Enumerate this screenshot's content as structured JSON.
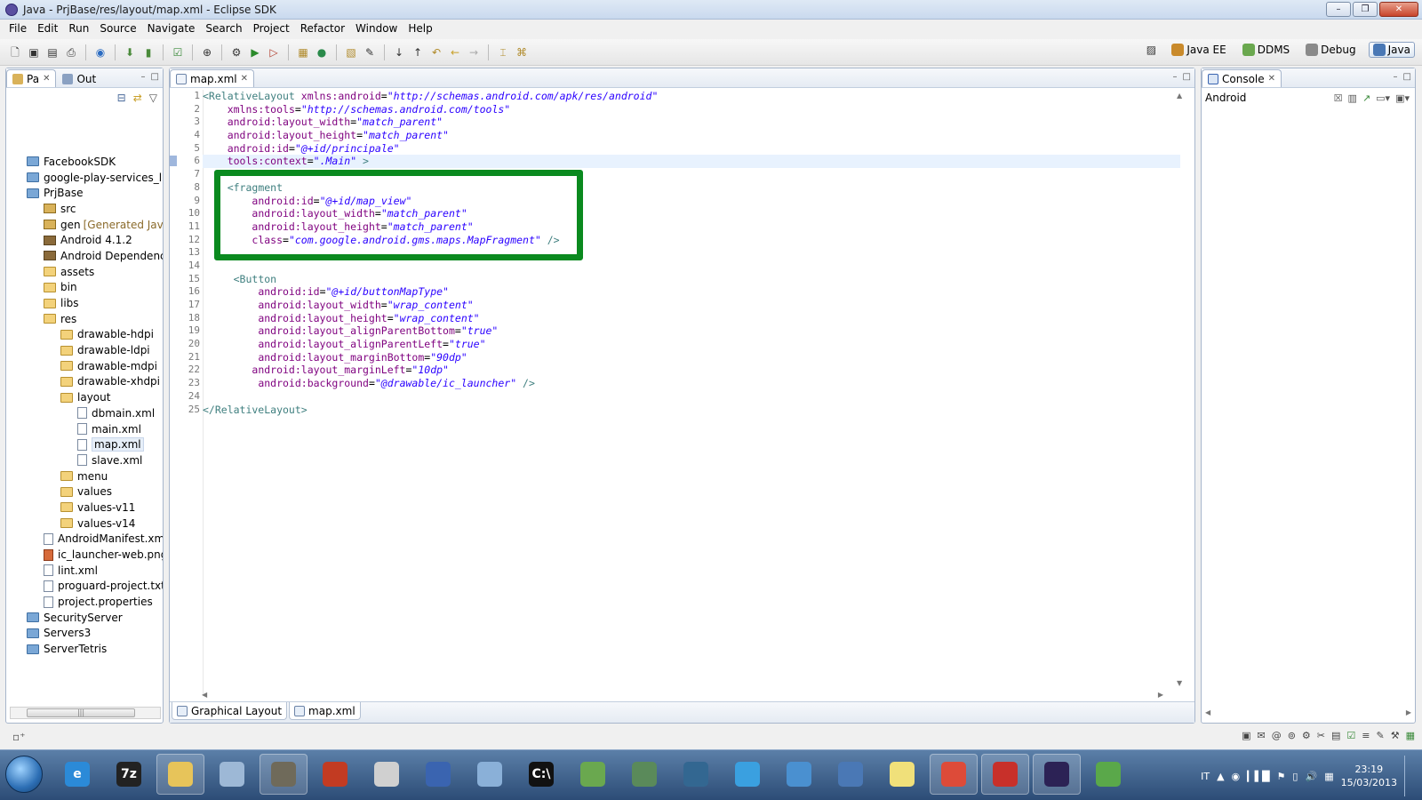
{
  "window": {
    "title": "Java - PrjBase/res/layout/map.xml - Eclipse SDK"
  },
  "menu": [
    "File",
    "Edit",
    "Run",
    "Source",
    "Navigate",
    "Search",
    "Project",
    "Refactor",
    "Window",
    "Help"
  ],
  "perspectives": [
    {
      "label": "Java EE",
      "color": "#c98a2b"
    },
    {
      "label": "DDMS",
      "color": "#6aa84f"
    },
    {
      "label": "Debug",
      "color": "#8a8a8a"
    },
    {
      "label": "Java",
      "color": "#4a78b5",
      "active": true
    }
  ],
  "explorer": {
    "tabs": [
      {
        "label": "Pa",
        "active": true
      },
      {
        "label": "Out",
        "active": false
      }
    ],
    "tree": [
      {
        "label": "FacebookSDK",
        "icon": "project-icon",
        "type": "proj",
        "indent": 1
      },
      {
        "label": "google-play-services_lib",
        "icon": "project-icon",
        "type": "proj",
        "indent": 1
      },
      {
        "label": "PrjBase",
        "icon": "project-icon",
        "type": "proj",
        "indent": 1
      },
      {
        "label": "src",
        "icon": "package-folder-icon",
        "type": "pkg",
        "indent": 2
      },
      {
        "label": "gen",
        "sub": "[Generated Java F",
        "icon": "package-folder-icon",
        "type": "pkg",
        "indent": 2
      },
      {
        "label": "Android 4.1.2",
        "icon": "library-icon",
        "type": "lib",
        "indent": 2
      },
      {
        "label": "Android Dependencie",
        "icon": "library-icon",
        "type": "lib",
        "indent": 2
      },
      {
        "label": "assets",
        "icon": "folder-icon",
        "type": "folder",
        "indent": 2
      },
      {
        "label": "bin",
        "icon": "folder-icon",
        "type": "folder",
        "indent": 2
      },
      {
        "label": "libs",
        "icon": "folder-icon",
        "type": "folder",
        "indent": 2
      },
      {
        "label": "res",
        "icon": "folder-icon",
        "type": "folder",
        "indent": 2
      },
      {
        "label": "drawable-hdpi",
        "icon": "folder-icon",
        "type": "folder",
        "indent": 3
      },
      {
        "label": "drawable-ldpi",
        "icon": "folder-icon",
        "type": "folder",
        "indent": 3
      },
      {
        "label": "drawable-mdpi",
        "icon": "folder-icon",
        "type": "folder",
        "indent": 3
      },
      {
        "label": "drawable-xhdpi",
        "icon": "folder-icon",
        "type": "folder",
        "indent": 3
      },
      {
        "label": "layout",
        "icon": "folder-icon",
        "type": "folder",
        "indent": 3
      },
      {
        "label": "dbmain.xml",
        "icon": "xml-file-icon",
        "type": "xml",
        "indent": 4
      },
      {
        "label": "main.xml",
        "icon": "xml-file-icon",
        "type": "xml",
        "indent": 4
      },
      {
        "label": "map.xml",
        "icon": "xml-file-icon",
        "type": "xml",
        "indent": 4,
        "selected": true
      },
      {
        "label": "slave.xml",
        "icon": "xml-file-icon",
        "type": "xml",
        "indent": 4
      },
      {
        "label": "menu",
        "icon": "folder-icon",
        "type": "folder",
        "indent": 3
      },
      {
        "label": "values",
        "icon": "folder-icon",
        "type": "folder",
        "indent": 3
      },
      {
        "label": "values-v11",
        "icon": "folder-icon",
        "type": "folder",
        "indent": 3
      },
      {
        "label": "values-v14",
        "icon": "folder-icon",
        "type": "folder",
        "indent": 3
      },
      {
        "label": "AndroidManifest.xml",
        "icon": "xml-file-icon",
        "type": "xml",
        "indent": 2
      },
      {
        "label": "ic_launcher-web.png",
        "icon": "image-file-icon",
        "type": "img",
        "indent": 2
      },
      {
        "label": "lint.xml",
        "icon": "xml-file-icon",
        "type": "xml",
        "indent": 2
      },
      {
        "label": "proguard-project.txt",
        "icon": "text-file-icon",
        "type": "file",
        "indent": 2
      },
      {
        "label": "project.properties",
        "icon": "text-file-icon",
        "type": "file",
        "indent": 2
      },
      {
        "label": "SecurityServer",
        "icon": "project-icon",
        "type": "proj",
        "indent": 1
      },
      {
        "label": "Servers3",
        "icon": "project-icon",
        "type": "proj",
        "indent": 1
      },
      {
        "label": "ServerTetris",
        "icon": "project-icon",
        "type": "proj",
        "indent": 1
      }
    ]
  },
  "editor": {
    "tab": "map.xml",
    "current_line": 6,
    "lines": [
      [
        [
          "t",
          "<RelativeLayout "
        ],
        [
          "a",
          "xmlns:android"
        ],
        [
          "p",
          "="
        ],
        [
          "v",
          "\"http://schemas.android.com/apk/res/android\""
        ]
      ],
      [
        [
          "p",
          "    "
        ],
        [
          "a",
          "xmlns:tools"
        ],
        [
          "p",
          "="
        ],
        [
          "v",
          "\"http://schemas.android.com/tools\""
        ]
      ],
      [
        [
          "p",
          "    "
        ],
        [
          "a",
          "android:layout_width"
        ],
        [
          "p",
          "="
        ],
        [
          "v",
          "\"match_parent\""
        ]
      ],
      [
        [
          "p",
          "    "
        ],
        [
          "a",
          "android:layout_height"
        ],
        [
          "p",
          "="
        ],
        [
          "v",
          "\"match_parent\""
        ]
      ],
      [
        [
          "p",
          "    "
        ],
        [
          "a",
          "android:id"
        ],
        [
          "p",
          "="
        ],
        [
          "v",
          "\"@+id/principale\""
        ]
      ],
      [
        [
          "p",
          "    "
        ],
        [
          "a",
          "tools:context"
        ],
        [
          "p",
          "="
        ],
        [
          "v",
          "\".Main\""
        ],
        [
          "t",
          " >"
        ]
      ],
      [],
      [
        [
          "p",
          "    "
        ],
        [
          "t",
          "<fragment"
        ]
      ],
      [
        [
          "p",
          "        "
        ],
        [
          "a",
          "android:id"
        ],
        [
          "p",
          "="
        ],
        [
          "v",
          "\"@+id/map_view\""
        ]
      ],
      [
        [
          "p",
          "        "
        ],
        [
          "a",
          "android:layout_width"
        ],
        [
          "p",
          "="
        ],
        [
          "v",
          "\"match_parent\""
        ]
      ],
      [
        [
          "p",
          "        "
        ],
        [
          "a",
          "android:layout_height"
        ],
        [
          "p",
          "="
        ],
        [
          "v",
          "\"match_parent\""
        ]
      ],
      [
        [
          "p",
          "        "
        ],
        [
          "a",
          "class"
        ],
        [
          "p",
          "="
        ],
        [
          "v",
          "\"com.google.android.gms.maps.MapFragment\""
        ],
        [
          "t",
          " />"
        ]
      ],
      [],
      [],
      [
        [
          "p",
          "     "
        ],
        [
          "t",
          "<Button"
        ]
      ],
      [
        [
          "p",
          "         "
        ],
        [
          "a",
          "android:id"
        ],
        [
          "p",
          "="
        ],
        [
          "v",
          "\"@+id/buttonMapType\""
        ]
      ],
      [
        [
          "p",
          "         "
        ],
        [
          "a",
          "android:layout_width"
        ],
        [
          "p",
          "="
        ],
        [
          "v",
          "\"wrap_content\""
        ]
      ],
      [
        [
          "p",
          "         "
        ],
        [
          "a",
          "android:layout_height"
        ],
        [
          "p",
          "="
        ],
        [
          "v",
          "\"wrap_content\""
        ]
      ],
      [
        [
          "p",
          "         "
        ],
        [
          "a",
          "android:layout_alignParentBottom"
        ],
        [
          "p",
          "="
        ],
        [
          "v",
          "\"true\""
        ]
      ],
      [
        [
          "p",
          "         "
        ],
        [
          "a",
          "android:layout_alignParentLeft"
        ],
        [
          "p",
          "="
        ],
        [
          "v",
          "\"true\""
        ]
      ],
      [
        [
          "p",
          "         "
        ],
        [
          "a",
          "android:layout_marginBottom"
        ],
        [
          "p",
          "="
        ],
        [
          "v",
          "\"90dp\""
        ]
      ],
      [
        [
          "p",
          "        "
        ],
        [
          "a",
          "android:layout_marginLeft"
        ],
        [
          "p",
          "="
        ],
        [
          "v",
          "\"10dp\""
        ]
      ],
      [
        [
          "p",
          "         "
        ],
        [
          "a",
          "android:background"
        ],
        [
          "p",
          "="
        ],
        [
          "v",
          "\"@drawable/ic_launcher\""
        ],
        [
          "t",
          " />"
        ]
      ],
      [],
      [
        [
          "t",
          "</RelativeLayout>"
        ]
      ]
    ],
    "bottom_tabs": [
      "Graphical Layout",
      "map.xml"
    ]
  },
  "console": {
    "tab": "Console",
    "label": "Android"
  },
  "taskbar": {
    "apps": [
      {
        "name": "ie-icon",
        "glyph": "e",
        "color": "#2b8ad8",
        "open": false
      },
      {
        "name": "7zip-icon",
        "glyph": "7z",
        "color": "#222222",
        "open": false
      },
      {
        "name": "explorer-icon",
        "glyph": "",
        "color": "#e7c45a",
        "open": true
      },
      {
        "name": "calculator-icon",
        "glyph": "",
        "color": "#9db8d6",
        "open": false
      },
      {
        "name": "gimp-icon",
        "glyph": "",
        "color": "#6f6a5a",
        "open": true
      },
      {
        "name": "filezilla-icon",
        "glyph": "",
        "color": "#c23b22",
        "open": false
      },
      {
        "name": "database-icon",
        "glyph": "",
        "color": "#d0d0d0",
        "open": false
      },
      {
        "name": "network-icon",
        "glyph": "",
        "color": "#3a64b0",
        "open": false
      },
      {
        "name": "settings-gear-icon",
        "glyph": "",
        "color": "#8ab0d8",
        "open": false
      },
      {
        "name": "cmd-icon",
        "glyph": "C:\\",
        "color": "#111111",
        "open": false
      },
      {
        "name": "task-manager-icon",
        "glyph": "",
        "color": "#6aa84f",
        "open": false
      },
      {
        "name": "window-icon",
        "glyph": "",
        "color": "#5a8a5a",
        "open": false
      },
      {
        "name": "postgres-icon",
        "glyph": "",
        "color": "#336791",
        "open": false
      },
      {
        "name": "media-player-icon",
        "glyph": "",
        "color": "#3aa0e0",
        "open": false
      },
      {
        "name": "azure-icon",
        "glyph": "",
        "color": "#4a90d0",
        "open": false
      },
      {
        "name": "remote-desktop-icon",
        "glyph": "",
        "color": "#4a78b5",
        "open": false
      },
      {
        "name": "sticky-notes-icon",
        "glyph": "",
        "color": "#f0e07a",
        "open": false
      },
      {
        "name": "chrome-icon",
        "glyph": "",
        "color": "#dd4b39",
        "open": true
      },
      {
        "name": "pdf-icon",
        "glyph": "",
        "color": "#c8302a",
        "open": true
      },
      {
        "name": "eclipse-icon",
        "glyph": "",
        "color": "#2c2255",
        "open": true
      },
      {
        "name": "download-icon",
        "glyph": "",
        "color": "#5aa84a",
        "open": false
      }
    ],
    "lang": "IT",
    "time": "23:19",
    "date": "15/03/2013"
  }
}
